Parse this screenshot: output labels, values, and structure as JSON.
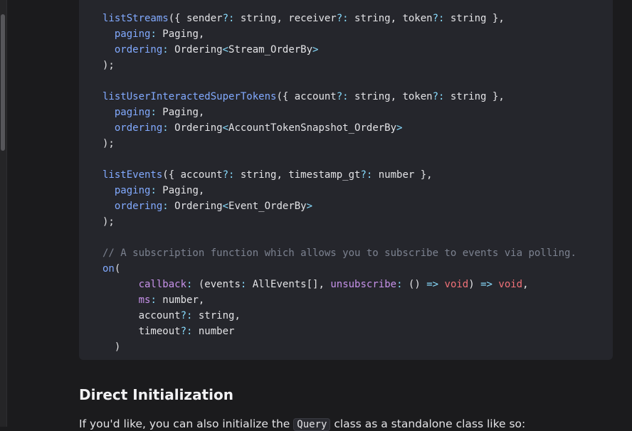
{
  "code": {
    "lines": [
      [
        {
          "t": "listStreams",
          "c": "fn"
        },
        {
          "t": "({ sender",
          "c": "txt"
        },
        {
          "t": "?:",
          "c": "punct"
        },
        {
          "t": " string, receiver",
          "c": "txt"
        },
        {
          "t": "?:",
          "c": "punct"
        },
        {
          "t": " string, token",
          "c": "txt"
        },
        {
          "t": "?:",
          "c": "punct"
        },
        {
          "t": " string },",
          "c": "txt"
        }
      ],
      [
        {
          "t": "  ",
          "c": "txt"
        },
        {
          "t": "paging",
          "c": "fn"
        },
        {
          "t": ":",
          "c": "punct"
        },
        {
          "t": " Paging,",
          "c": "txt"
        }
      ],
      [
        {
          "t": "  ",
          "c": "txt"
        },
        {
          "t": "ordering",
          "c": "fn"
        },
        {
          "t": ":",
          "c": "punct"
        },
        {
          "t": " Ordering",
          "c": "txt"
        },
        {
          "t": "<",
          "c": "punct"
        },
        {
          "t": "Stream_OrderBy",
          "c": "txt"
        },
        {
          "t": ">",
          "c": "punct"
        }
      ],
      [
        {
          "t": ");",
          "c": "txt"
        }
      ],
      [],
      [
        {
          "t": "listUserInteractedSuperTokens",
          "c": "fn"
        },
        {
          "t": "({ account",
          "c": "txt"
        },
        {
          "t": "?:",
          "c": "punct"
        },
        {
          "t": " string, token",
          "c": "txt"
        },
        {
          "t": "?:",
          "c": "punct"
        },
        {
          "t": " string },",
          "c": "txt"
        }
      ],
      [
        {
          "t": "  ",
          "c": "txt"
        },
        {
          "t": "paging",
          "c": "fn"
        },
        {
          "t": ":",
          "c": "punct"
        },
        {
          "t": " Paging,",
          "c": "txt"
        }
      ],
      [
        {
          "t": "  ",
          "c": "txt"
        },
        {
          "t": "ordering",
          "c": "fn"
        },
        {
          "t": ":",
          "c": "punct"
        },
        {
          "t": " Ordering",
          "c": "txt"
        },
        {
          "t": "<",
          "c": "punct"
        },
        {
          "t": "AccountTokenSnapshot_OrderBy",
          "c": "txt"
        },
        {
          "t": ">",
          "c": "punct"
        }
      ],
      [
        {
          "t": ");",
          "c": "txt"
        }
      ],
      [],
      [
        {
          "t": "listEvents",
          "c": "fn"
        },
        {
          "t": "({ account",
          "c": "txt"
        },
        {
          "t": "?:",
          "c": "punct"
        },
        {
          "t": " string, timestamp_gt",
          "c": "txt"
        },
        {
          "t": "?:",
          "c": "punct"
        },
        {
          "t": " number },",
          "c": "txt"
        }
      ],
      [
        {
          "t": "  ",
          "c": "txt"
        },
        {
          "t": "paging",
          "c": "fn"
        },
        {
          "t": ":",
          "c": "punct"
        },
        {
          "t": " Paging,",
          "c": "txt"
        }
      ],
      [
        {
          "t": "  ",
          "c": "txt"
        },
        {
          "t": "ordering",
          "c": "fn"
        },
        {
          "t": ":",
          "c": "punct"
        },
        {
          "t": " Ordering",
          "c": "txt"
        },
        {
          "t": "<",
          "c": "punct"
        },
        {
          "t": "Event_OrderBy",
          "c": "txt"
        },
        {
          "t": ">",
          "c": "punct"
        }
      ],
      [
        {
          "t": ");",
          "c": "txt"
        }
      ],
      [],
      [
        {
          "t": "// A subscription function which allows you to subscribe to events via polling.",
          "c": "cm"
        }
      ],
      [
        {
          "t": "on",
          "c": "fn"
        },
        {
          "t": "(",
          "c": "txt"
        }
      ],
      [
        {
          "t": "      ",
          "c": "txt"
        },
        {
          "t": "callback",
          "c": "prop"
        },
        {
          "t": ":",
          "c": "punct"
        },
        {
          "t": " (events",
          "c": "txt"
        },
        {
          "t": ":",
          "c": "punct"
        },
        {
          "t": " AllEvents[], ",
          "c": "txt"
        },
        {
          "t": "unsubscribe",
          "c": "prop"
        },
        {
          "t": ":",
          "c": "punct"
        },
        {
          "t": " () ",
          "c": "txt"
        },
        {
          "t": "=>",
          "c": "punct"
        },
        {
          "t": " ",
          "c": "txt"
        },
        {
          "t": "void",
          "c": "kw"
        },
        {
          "t": ") ",
          "c": "txt"
        },
        {
          "t": "=>",
          "c": "punct"
        },
        {
          "t": " ",
          "c": "txt"
        },
        {
          "t": "void",
          "c": "kw"
        },
        {
          "t": ",",
          "c": "txt"
        }
      ],
      [
        {
          "t": "      ",
          "c": "txt"
        },
        {
          "t": "ms",
          "c": "prop"
        },
        {
          "t": ":",
          "c": "punct"
        },
        {
          "t": " number,",
          "c": "txt"
        }
      ],
      [
        {
          "t": "      account",
          "c": "txt"
        },
        {
          "t": "?:",
          "c": "punct"
        },
        {
          "t": " string,",
          "c": "txt"
        }
      ],
      [
        {
          "t": "      timeout",
          "c": "txt"
        },
        {
          "t": "?:",
          "c": "punct"
        },
        {
          "t": " number",
          "c": "txt"
        }
      ],
      [
        {
          "t": "  )",
          "c": "txt"
        }
      ]
    ]
  },
  "section": {
    "heading": "Direct Initialization",
    "intro_before": "If you'd like, you can also initialize the ",
    "intro_code": "Query",
    "intro_after": " class as a standalone class like so:"
  },
  "colors": {
    "background": "#1b1b1d",
    "code_background": "#25262c",
    "function": "#82aaff",
    "property": "#c792ea",
    "punctuation": "#89ddff",
    "keyword": "#f07178",
    "comment": "#7c8290"
  }
}
